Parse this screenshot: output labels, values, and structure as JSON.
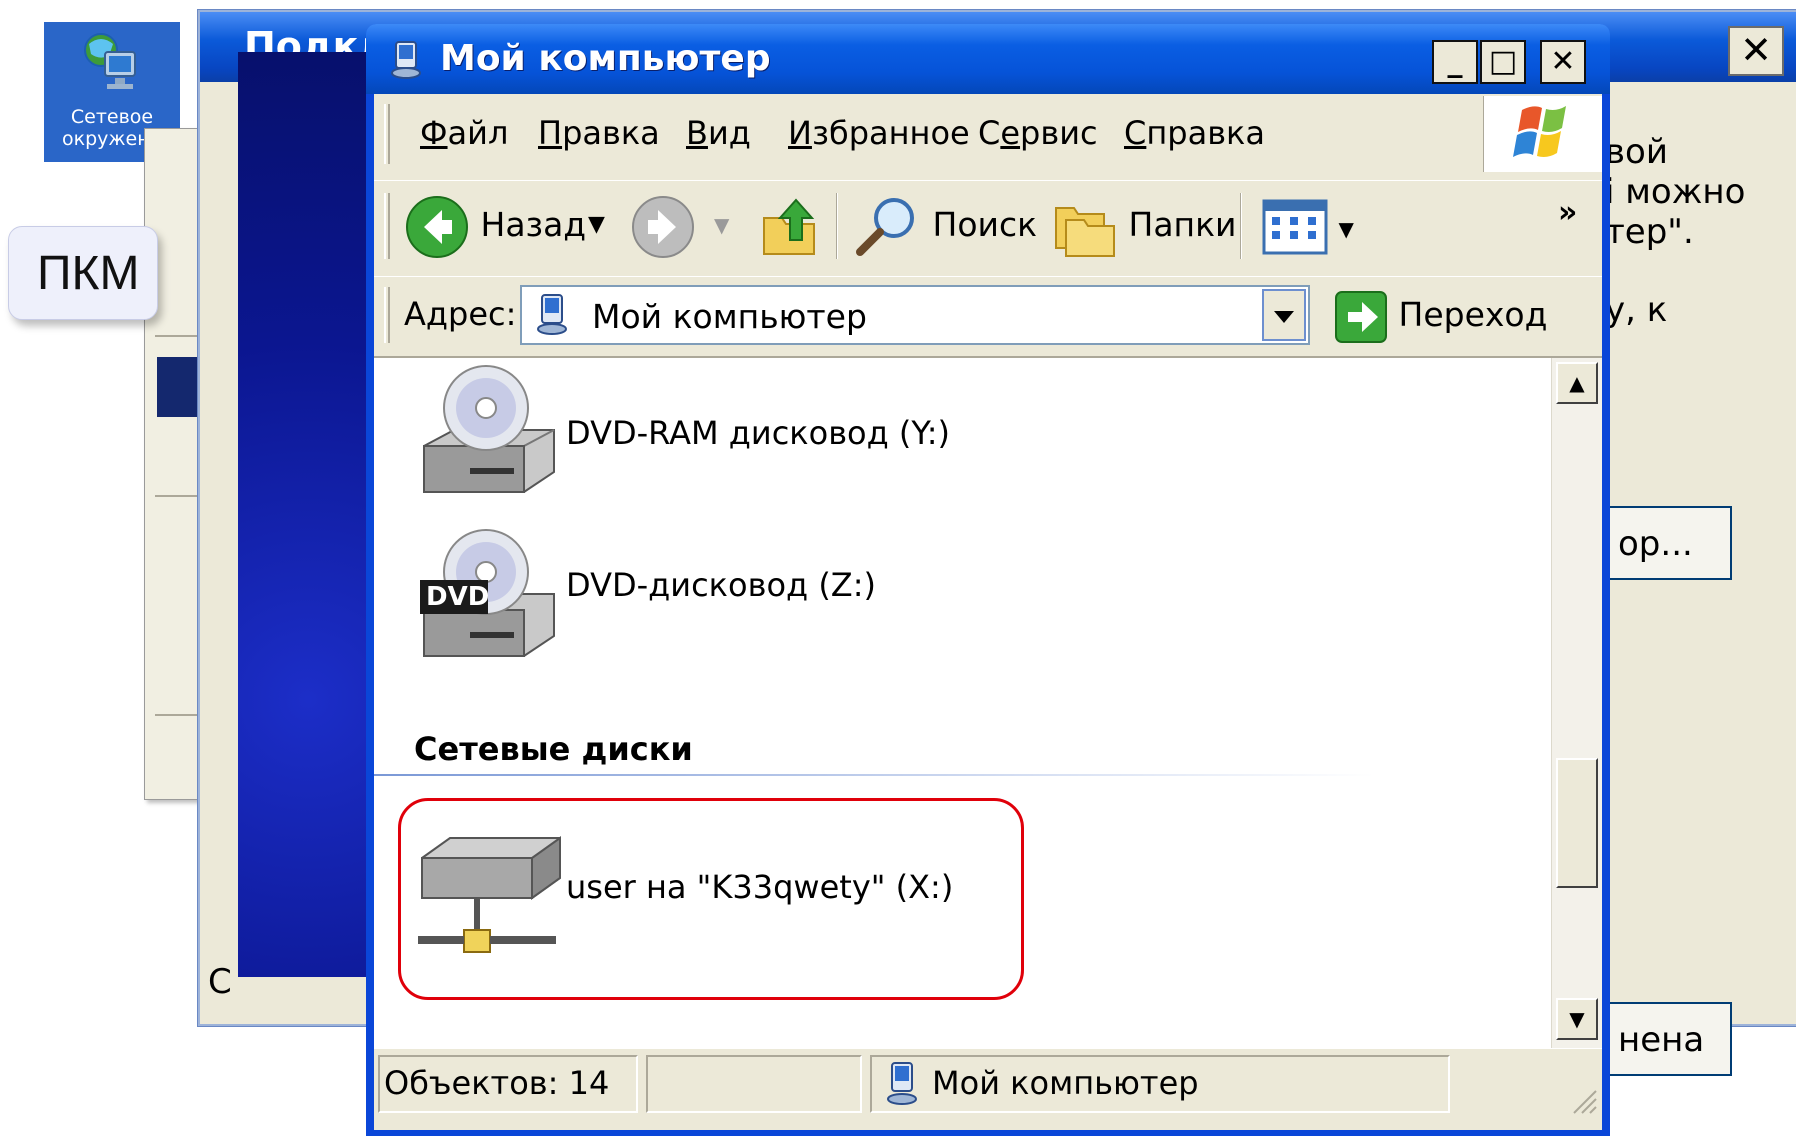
{
  "desktop": {
    "icon_label": "Сетевое\nокружени"
  },
  "callout": {
    "text": "ПКМ"
  },
  "connect_dialog": {
    "title": "Подкл",
    "close": "✕",
    "right_text": [
      "вой",
      "і можно",
      "тер\".",
      "у, к"
    ],
    "browse_button": "ор...",
    "cancel_button": "нена",
    "left_letter": "С"
  },
  "explorer": {
    "title": "Мой компьютер",
    "controls": {
      "minimize": "_",
      "maximize": "□",
      "close": "✕"
    },
    "menu": [
      {
        "label": "Файл",
        "key": "Ф",
        "rest": "айл"
      },
      {
        "label": "Правка",
        "key": "П",
        "rest": "равка"
      },
      {
        "label": "Вид",
        "key": "В",
        "rest": "ид"
      },
      {
        "label": "Избранное",
        "key": "И",
        "rest": "збранное"
      },
      {
        "label": "Сервис",
        "pre": "С",
        "key": "е",
        "rest": "рвис"
      },
      {
        "label": "Справка",
        "key": "С",
        "rest": "правка"
      }
    ],
    "toolbar": {
      "back": "Назад",
      "search": "Поиск",
      "folders": "Папки",
      "more": "»"
    },
    "address": {
      "label": "Адрес:",
      "value": "Мой компьютер",
      "go": "Переход"
    },
    "items": [
      {
        "label": "DVD-RAM дисковод (Y:)",
        "icon": "dvd-ram-drive-icon"
      },
      {
        "label": "DVD-дисковод (Z:)",
        "icon": "dvd-drive-icon",
        "badge": "DVD"
      }
    ],
    "group_header": "Сетевые диски",
    "network_items": [
      {
        "label": "user на \"K33qwety\" (X:)",
        "icon": "network-drive-icon"
      }
    ],
    "status": {
      "objects": "Объектов: 14",
      "location": "Мой компьютер"
    },
    "colors": {
      "highlight": "#e0000a",
      "titlebar": "#0653d8"
    }
  }
}
